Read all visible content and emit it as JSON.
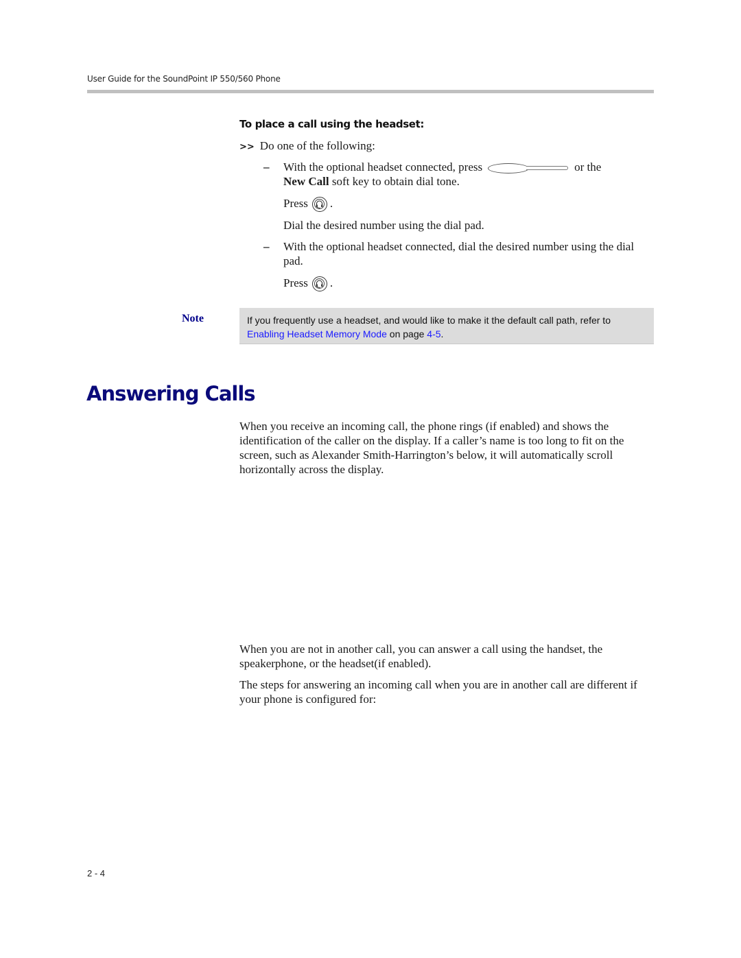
{
  "header": {
    "running_title": "User Guide for the SoundPoint IP 550/560 Phone"
  },
  "procedure": {
    "heading": "To place a call using the headset:",
    "step_marker": ">>",
    "step_text": "Do one of the following:",
    "options": [
      {
        "dash": "–",
        "text_before_key": "With the optional headset connected, press",
        "key_icon": "line-key-icon",
        "text_after_key": "or the",
        "bold_term": "New Call",
        "text_rest": " soft key to obtain dial tone.",
        "press_label": "Press",
        "press_icon": "headset-icon",
        "press_period": ".",
        "followup": "Dial the desired number using the dial pad."
      },
      {
        "dash": "–",
        "text": "With the optional headset connected, dial the desired number using the dial pad.",
        "press_label": "Press",
        "press_icon": "headset-icon",
        "press_period": "."
      }
    ]
  },
  "note": {
    "label": "Note",
    "text_before_link": "If you frequently use a headset, and would like to make it the default call path, refer to ",
    "link_text": "Enabling Headset Memory Mode",
    "text_middle": " on page ",
    "page_link": "4-5",
    "text_end": "."
  },
  "section": {
    "title": "Answering Calls",
    "paragraphs": [
      "When you receive an incoming call, the phone rings (if enabled) and shows the identification of the caller on the display. If a caller’s name is too long to fit on the screen, such as Alexander Smith-Harrington’s below, it will automatically scroll horizontally across the display.",
      "When you are not in another call, you can answer a call using the handset, the speakerphone, or the headset(if enabled).",
      "The steps for answering an incoming call when you are in another call are different if your phone is configured for:"
    ]
  },
  "footer": {
    "page_number": "2 - 4"
  },
  "colors": {
    "heading_blue": "#0a0a7a",
    "link_blue": "#1a1aff",
    "note_bg": "#dcdcdc",
    "rule_gray": "#c0c0c0"
  }
}
